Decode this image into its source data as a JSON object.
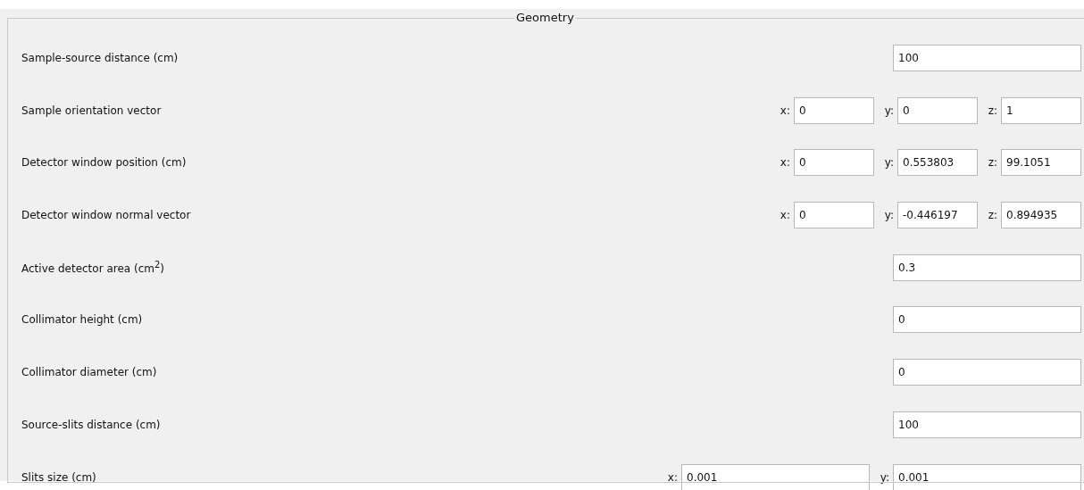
{
  "group": {
    "title": "Geometry"
  },
  "rows": [
    {
      "label": "Sample-source distance (cm)",
      "kind": "single",
      "fields": [
        {
          "value": "100"
        }
      ]
    },
    {
      "label": "Sample orientation vector",
      "kind": "vector3",
      "fields": [
        {
          "axis": "x:",
          "value": "0"
        },
        {
          "axis": "y:",
          "value": "0"
        },
        {
          "axis": "z:",
          "value": "1"
        }
      ]
    },
    {
      "label": "Detector window position (cm)",
      "kind": "vector3",
      "fields": [
        {
          "axis": "x:",
          "value": "0"
        },
        {
          "axis": "y:",
          "value": "0.553803"
        },
        {
          "axis": "z:",
          "value": "99.1051"
        }
      ]
    },
    {
      "label": "Detector window normal vector",
      "kind": "vector3",
      "fields": [
        {
          "axis": "x:",
          "value": "0"
        },
        {
          "axis": "y:",
          "value": "-0.446197"
        },
        {
          "axis": "z:",
          "value": "0.894935"
        }
      ]
    },
    {
      "label": "Active detector area (cm$^{2}$)",
      "kind": "single",
      "fields": [
        {
          "value": "0.3"
        }
      ]
    },
    {
      "label": "Collimator height (cm)",
      "kind": "single",
      "fields": [
        {
          "value": "0"
        }
      ]
    },
    {
      "label": "Collimator diameter (cm)",
      "kind": "single",
      "fields": [
        {
          "value": "0"
        }
      ]
    },
    {
      "label": "Source-slits distance (cm)",
      "kind": "single",
      "fields": [
        {
          "value": "100"
        }
      ]
    },
    {
      "label": "Slits size (cm)",
      "kind": "vector2",
      "fields": [
        {
          "axis": "x:",
          "value": "0.001"
        },
        {
          "axis": "y:",
          "value": "0.001"
        }
      ]
    }
  ]
}
